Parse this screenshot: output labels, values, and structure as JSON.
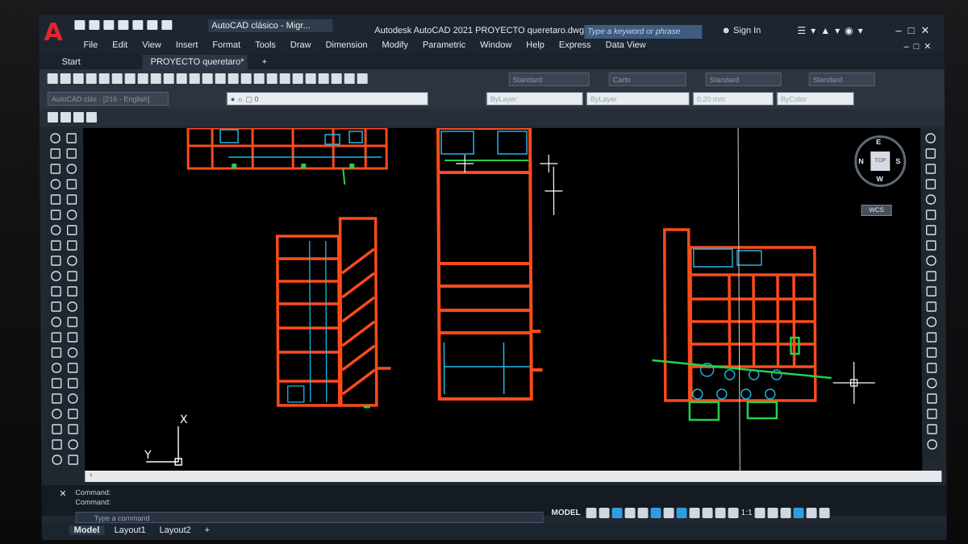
{
  "app": {
    "workspace": "AutoCAD clásico - Migr...",
    "window_title": "Autodesk AutoCAD 2021   PROYECTO queretaro.dwg",
    "search_placeholder": "Type a keyword or phrase",
    "sign_in": "Sign In"
  },
  "menu": [
    "File",
    "Edit",
    "View",
    "Insert",
    "Format",
    "Tools",
    "Draw",
    "Dimension",
    "Modify",
    "Parametric",
    "Window",
    "Help",
    "Express",
    "Data View"
  ],
  "tabs": {
    "start": "Start",
    "active": "PROYECTO queretaro*",
    "add": "+"
  },
  "toolbar": {
    "text_style": "Standard",
    "dim_style": "Carto",
    "table_style": "Standard",
    "mleader_style": "Standard",
    "workspace_combo": "AutoCAD clás · [216 - English]",
    "layer": "0",
    "color": "ByLayer",
    "linetype": "ByLayer",
    "lineweight": "0.20 mm",
    "plotstyle": "ByColor"
  },
  "viewcube": {
    "top": "TOP",
    "n": "N",
    "s": "S",
    "e": "E",
    "w": "W",
    "wcs": "WCS"
  },
  "ucs": {
    "x": "X",
    "y": "Y"
  },
  "command": {
    "line1": "Command:",
    "line2": "Command:",
    "input_placeholder": "Type a command"
  },
  "layouts": [
    "Model",
    "Layout1",
    "Layout2"
  ],
  "status": {
    "model": "MODEL",
    "scale": "1:1"
  },
  "colors": {
    "drawing": "#ff4a1c",
    "cyan": "#1fb8e8",
    "green": "#24d14a",
    "background": "#000000"
  }
}
